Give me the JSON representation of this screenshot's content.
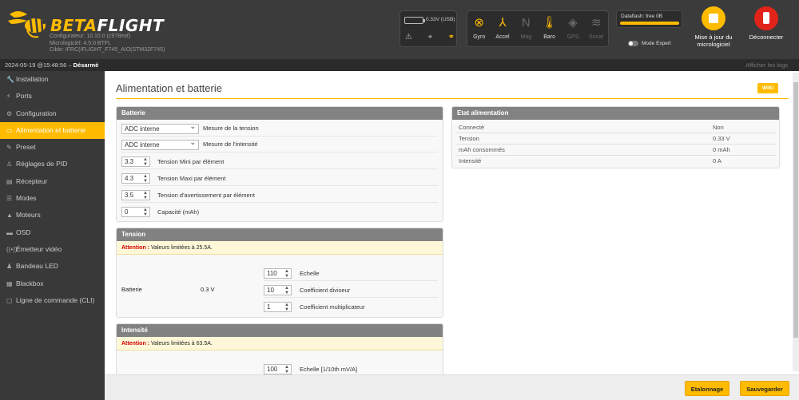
{
  "header": {
    "logo_part1": "BETA",
    "logo_part2": "FLIGHT",
    "configurator": "Configurateur: 10.10.0 (c978eaf)",
    "firmware": "Micrologiciel: 4.5.0 BTFL",
    "target": "Cible: IFRC(IFLIGHT_F745_AIO(STM32F745)",
    "battery_text": "0.33V (USB)",
    "sensors": [
      {
        "label": "Gyro",
        "icon": "gyro-icon",
        "active": true
      },
      {
        "label": "Accel",
        "icon": "accel-icon",
        "active": true
      },
      {
        "label": "Mag",
        "icon": "mag-icon",
        "active": false
      },
      {
        "label": "Baro",
        "icon": "baro-icon",
        "active": true
      },
      {
        "label": "GPS",
        "icon": "gps-icon",
        "active": false
      },
      {
        "label": "Sonar",
        "icon": "sonar-icon",
        "active": false
      }
    ],
    "dataflash": "Dataflash: free 0B",
    "expert_mode": "Mode Expert",
    "firmware_update": "Mise à jour du micrologiciel",
    "disconnect": "Déconnecter"
  },
  "logbar": {
    "timestamp": "2024-05-19 @15:48:56 – ",
    "state": "Désarmé",
    "show_logs": "Afficher les logs"
  },
  "sidebar": {
    "items": [
      {
        "label": "Installation",
        "icon": "wrench-icon"
      },
      {
        "label": "Ports",
        "icon": "plug-icon"
      },
      {
        "label": "Configuration",
        "icon": "gear-icon"
      },
      {
        "label": "Alimentation et batterie",
        "icon": "battery-icon",
        "active": true
      },
      {
        "label": "Preset",
        "icon": "preset-icon"
      },
      {
        "label": "Réglages de PID",
        "icon": "sliders-icon"
      },
      {
        "label": "Récepteur",
        "icon": "receiver-icon"
      },
      {
        "label": "Modes",
        "icon": "modes-icon"
      },
      {
        "label": "Moteurs",
        "icon": "motor-icon"
      },
      {
        "label": "OSD",
        "icon": "osd-icon"
      },
      {
        "label": "Émetteur vidéo",
        "icon": "vtx-icon"
      },
      {
        "label": "Bandeau LED",
        "icon": "led-icon"
      },
      {
        "label": "Blackbox",
        "icon": "blackbox-icon"
      },
      {
        "label": "Ligne de commande (CLI)",
        "icon": "terminal-icon"
      }
    ]
  },
  "main": {
    "title": "Alimentation et batterie",
    "wiki": "WIKI",
    "battery": {
      "title": "Batterie",
      "voltage_meter": {
        "value": "ADC interne",
        "label": "Mesure de la tension"
      },
      "current_meter": {
        "value": "ADC interne",
        "label": "Mesure de l'intensité"
      },
      "min_cell": {
        "value": "3.3",
        "label": "Tension Mini par élément"
      },
      "max_cell": {
        "value": "4.3",
        "label": "Tension Maxi par élément"
      },
      "warn_cell": {
        "value": "3.5",
        "label": "Tension d'avertissement par élément"
      },
      "capacity": {
        "value": "0",
        "label": "Capacité (mAh)"
      }
    },
    "voltage": {
      "title": "Tension",
      "warning_bold": "Attention :",
      "warning_text": " Valeurs limitées à 25.5A.",
      "source": "Batterie",
      "reading": "0.3 V",
      "scale": {
        "value": "110",
        "label": "Echelle"
      },
      "divider": {
        "value": "10",
        "label": "Coefficient diviseur"
      },
      "multiplier": {
        "value": "1",
        "label": "Coefficient multiplicateur"
      }
    },
    "current": {
      "title": "Intensité",
      "warning_bold": "Attention :",
      "warning_text": " Valeurs limitées à 63.5A.",
      "scale": {
        "value": "100",
        "label": "Echelle [1/10th mV/A]"
      }
    },
    "power_state": {
      "title": "Etat alimentation",
      "rows": [
        {
          "key": "Connecté",
          "value": "Non"
        },
        {
          "key": "Tension",
          "value": "0.33 V"
        },
        {
          "key": "mAh consommés",
          "value": "0 mAh"
        },
        {
          "key": "Intensité",
          "value": "0 A"
        }
      ]
    }
  },
  "footer": {
    "calibration": "Etalonnage",
    "save": "Sauvegarder"
  }
}
